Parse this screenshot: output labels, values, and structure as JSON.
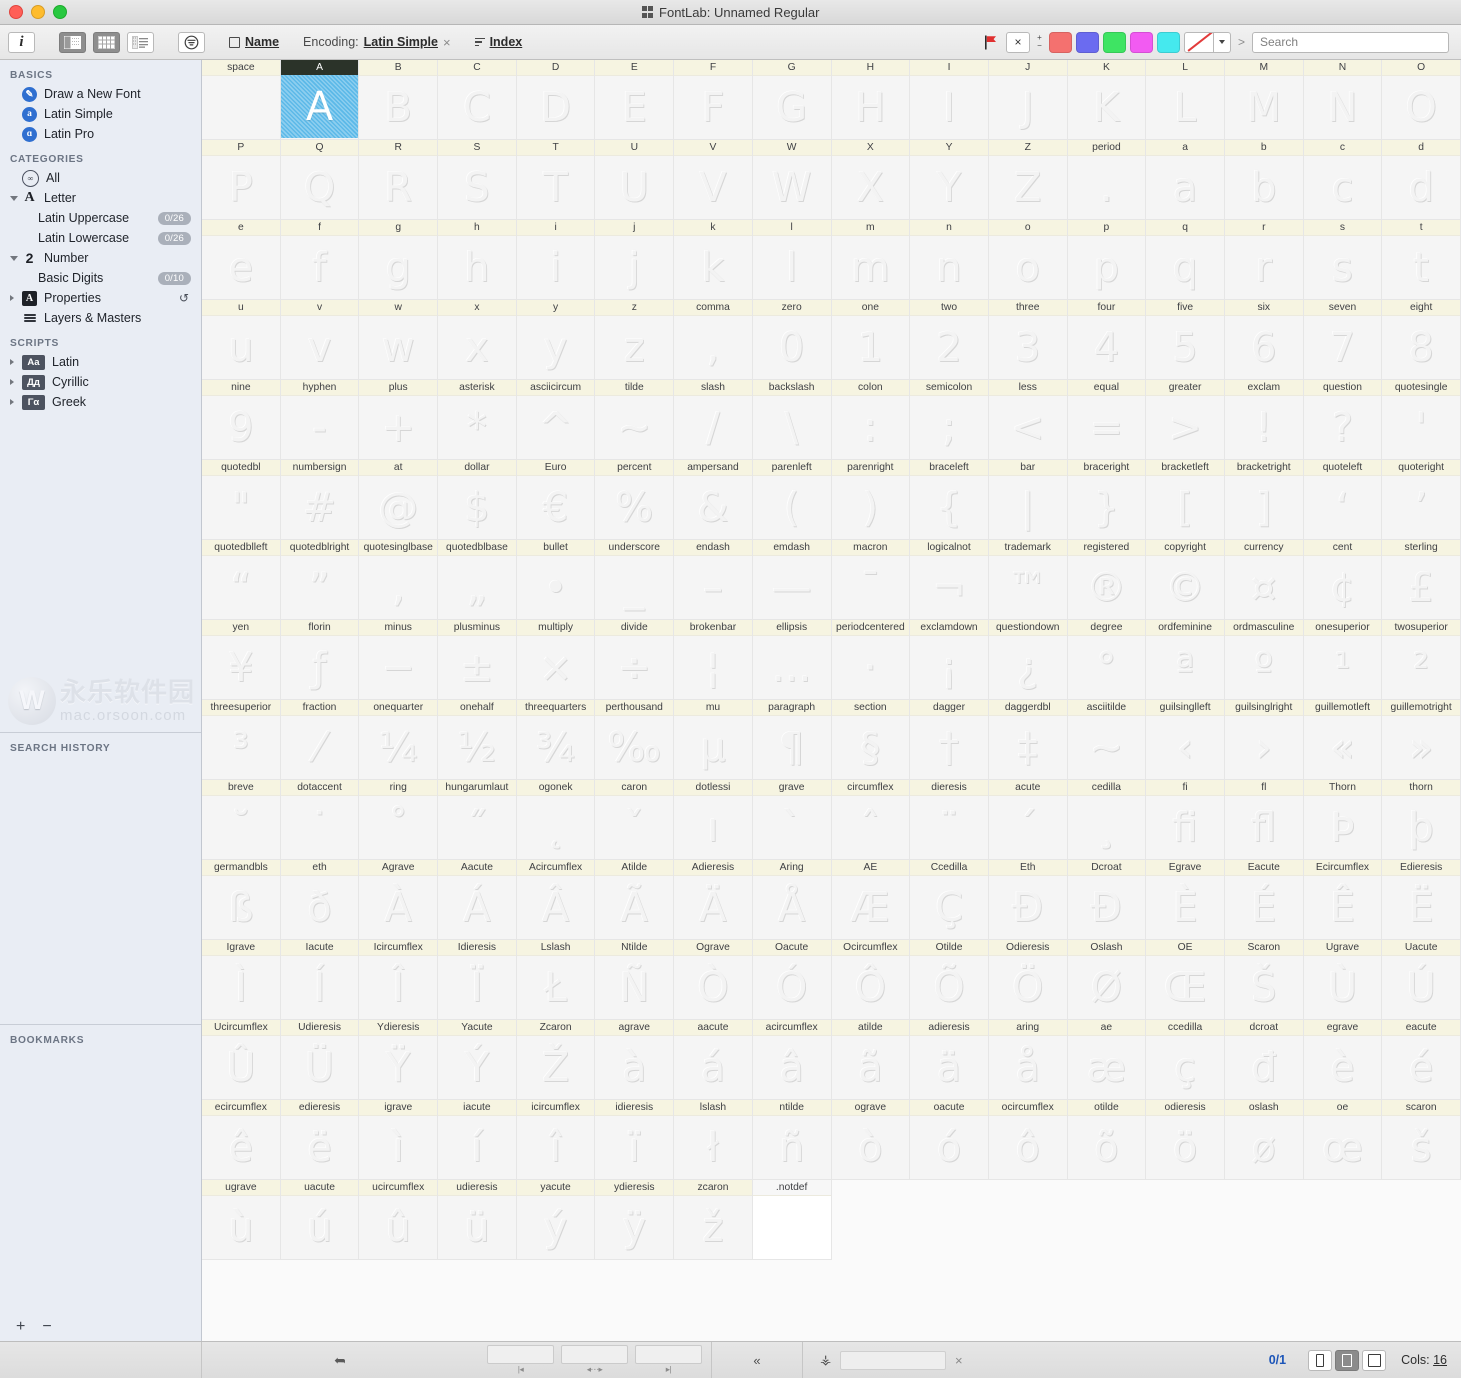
{
  "window": {
    "title": "FontLab: Unnamed Regular",
    "traffic": [
      "close",
      "minimize",
      "zoom"
    ]
  },
  "toolbar": {
    "info_label": "i",
    "view_buttons": [
      "panel-view",
      "grid-view",
      "list-view"
    ],
    "filter_label": "filter",
    "name_label": "Name",
    "encoding_prefix": "Encoding:",
    "encoding_value": "Latin Simple",
    "encoding_clear": "×",
    "index_label": "Index",
    "flag_label": "flag",
    "clear_mark_label": "×",
    "plus_label": "+",
    "minus_label": "−",
    "swatches": [
      "#f4716f",
      "#6b6bf0",
      "#3ee463",
      "#f25bf2",
      "#45e9ee"
    ],
    "slash_label": "no-color",
    "caret_label": "▾",
    "gt_label": ">",
    "search_placeholder": "Search",
    "search_value": ""
  },
  "sidebar": {
    "sections": [
      {
        "title": "BASICS",
        "items": [
          {
            "label": "Draw a New Font",
            "icon": "pen-circle-icon",
            "icon_text": "✐",
            "indent": false
          },
          {
            "label": "Latin Simple",
            "icon": "a-circle-icon",
            "icon_text": "a",
            "indent": false
          },
          {
            "label": "Latin Pro",
            "icon": "a-pro-circle-icon",
            "icon_text": "ɑ",
            "indent": false
          }
        ]
      },
      {
        "title": "CATEGORIES",
        "items": [
          {
            "label": "All",
            "icon": "infinity-circle-icon",
            "icon_text": "∞",
            "indent": false
          },
          {
            "label": "Letter",
            "icon": "letter-a-icon",
            "icon_text": "A",
            "indent": false,
            "disclosure": "open"
          },
          {
            "label": "Latin Uppercase",
            "indent": true,
            "count": "0/26"
          },
          {
            "label": "Latin Lowercase",
            "indent": true,
            "count": "0/26"
          },
          {
            "label": "Number",
            "icon": "number-2-icon",
            "icon_text": "2",
            "indent": false,
            "disclosure": "open"
          },
          {
            "label": "Basic Digits",
            "indent": true,
            "count": "0/10"
          },
          {
            "label": "Properties",
            "icon": "properties-icon",
            "icon_text": "A",
            "indent": false,
            "disclosure": "closed",
            "accessory": "↺"
          },
          {
            "label": "Layers & Masters",
            "icon": "layers-icon",
            "indent": false
          }
        ]
      },
      {
        "title": "SCRIPTS",
        "items": [
          {
            "label": "Latin",
            "icon": "script-latin-icon",
            "icon_text": "Aa",
            "indent": false,
            "disclosure": "closed"
          },
          {
            "label": "Cyrillic",
            "icon": "script-cyrillic-icon",
            "icon_text": "Дд",
            "indent": false,
            "disclosure": "closed"
          },
          {
            "label": "Greek",
            "icon": "script-greek-icon",
            "icon_text": "Γα",
            "indent": false,
            "disclosure": "closed"
          }
        ]
      }
    ],
    "watermark": {
      "cn": "永乐软件园",
      "en": "mac.orsoon.com",
      "mark": "W"
    },
    "search_history_title": "SEARCH HISTORY",
    "bookmarks_title": "BOOKMARKS",
    "footer": {
      "add": "+",
      "remove": "−"
    }
  },
  "statusbar": {
    "cursor_icon": "cursor-icon",
    "slider_hints": [
      "|◂",
      "◂⋯▸",
      "▸|"
    ],
    "collapse_icon": "«",
    "stamp_icon": "stamp-icon",
    "lock_clear": "×",
    "selection_count": "0/1",
    "view_modes": [
      "narrow",
      "medium",
      "wide"
    ],
    "active_view_mode": 1,
    "cols_label": "Cols:",
    "cols_value": "16"
  },
  "grid": {
    "columns": 16,
    "selected": "A",
    "cells": [
      {
        "name": "space",
        "glyph": ""
      },
      {
        "name": "A",
        "glyph": "A",
        "selected": true
      },
      {
        "name": "B",
        "glyph": "B"
      },
      {
        "name": "C",
        "glyph": "C"
      },
      {
        "name": "D",
        "glyph": "D"
      },
      {
        "name": "E",
        "glyph": "E"
      },
      {
        "name": "F",
        "glyph": "F"
      },
      {
        "name": "G",
        "glyph": "G"
      },
      {
        "name": "H",
        "glyph": "H"
      },
      {
        "name": "I",
        "glyph": "I"
      },
      {
        "name": "J",
        "glyph": "J"
      },
      {
        "name": "K",
        "glyph": "K"
      },
      {
        "name": "L",
        "glyph": "L"
      },
      {
        "name": "M",
        "glyph": "M"
      },
      {
        "name": "N",
        "glyph": "N"
      },
      {
        "name": "O",
        "glyph": "O"
      },
      {
        "name": "P",
        "glyph": "P"
      },
      {
        "name": "Q",
        "glyph": "Q"
      },
      {
        "name": "R",
        "glyph": "R"
      },
      {
        "name": "S",
        "glyph": "S"
      },
      {
        "name": "T",
        "glyph": "T"
      },
      {
        "name": "U",
        "glyph": "U"
      },
      {
        "name": "V",
        "glyph": "V"
      },
      {
        "name": "W",
        "glyph": "W"
      },
      {
        "name": "X",
        "glyph": "X"
      },
      {
        "name": "Y",
        "glyph": "Y"
      },
      {
        "name": "Z",
        "glyph": "Z"
      },
      {
        "name": "period",
        "glyph": "."
      },
      {
        "name": "a",
        "glyph": "a"
      },
      {
        "name": "b",
        "glyph": "b"
      },
      {
        "name": "c",
        "glyph": "c"
      },
      {
        "name": "d",
        "glyph": "d"
      },
      {
        "name": "e",
        "glyph": "e"
      },
      {
        "name": "f",
        "glyph": "f"
      },
      {
        "name": "g",
        "glyph": "g"
      },
      {
        "name": "h",
        "glyph": "h"
      },
      {
        "name": "i",
        "glyph": "i"
      },
      {
        "name": "j",
        "glyph": "j"
      },
      {
        "name": "k",
        "glyph": "k"
      },
      {
        "name": "l",
        "glyph": "l"
      },
      {
        "name": "m",
        "glyph": "m"
      },
      {
        "name": "n",
        "glyph": "n"
      },
      {
        "name": "o",
        "glyph": "o"
      },
      {
        "name": "p",
        "glyph": "p"
      },
      {
        "name": "q",
        "glyph": "q"
      },
      {
        "name": "r",
        "glyph": "r"
      },
      {
        "name": "s",
        "glyph": "s"
      },
      {
        "name": "t",
        "glyph": "t"
      },
      {
        "name": "u",
        "glyph": "u"
      },
      {
        "name": "v",
        "glyph": "v"
      },
      {
        "name": "w",
        "glyph": "w"
      },
      {
        "name": "x",
        "glyph": "x"
      },
      {
        "name": "y",
        "glyph": "y"
      },
      {
        "name": "z",
        "glyph": "z"
      },
      {
        "name": "comma",
        "glyph": ","
      },
      {
        "name": "zero",
        "glyph": "0"
      },
      {
        "name": "one",
        "glyph": "1"
      },
      {
        "name": "two",
        "glyph": "2"
      },
      {
        "name": "three",
        "glyph": "3"
      },
      {
        "name": "four",
        "glyph": "4"
      },
      {
        "name": "five",
        "glyph": "5"
      },
      {
        "name": "six",
        "glyph": "6"
      },
      {
        "name": "seven",
        "glyph": "7"
      },
      {
        "name": "eight",
        "glyph": "8"
      },
      {
        "name": "nine",
        "glyph": "9"
      },
      {
        "name": "hyphen",
        "glyph": "-"
      },
      {
        "name": "plus",
        "glyph": "+"
      },
      {
        "name": "asterisk",
        "glyph": "*"
      },
      {
        "name": "asciicircum",
        "glyph": "^"
      },
      {
        "name": "tilde",
        "glyph": "~"
      },
      {
        "name": "slash",
        "glyph": "/"
      },
      {
        "name": "backslash",
        "glyph": "\\"
      },
      {
        "name": "colon",
        "glyph": ":"
      },
      {
        "name": "semicolon",
        "glyph": ";"
      },
      {
        "name": "less",
        "glyph": "<"
      },
      {
        "name": "equal",
        "glyph": "="
      },
      {
        "name": "greater",
        "glyph": ">"
      },
      {
        "name": "exclam",
        "glyph": "!"
      },
      {
        "name": "question",
        "glyph": "?"
      },
      {
        "name": "quotesingle",
        "glyph": "'"
      },
      {
        "name": "quotedbl",
        "glyph": "\""
      },
      {
        "name": "numbersign",
        "glyph": "#"
      },
      {
        "name": "at",
        "glyph": "@"
      },
      {
        "name": "dollar",
        "glyph": "$"
      },
      {
        "name": "Euro",
        "glyph": "€"
      },
      {
        "name": "percent",
        "glyph": "%"
      },
      {
        "name": "ampersand",
        "glyph": "&"
      },
      {
        "name": "parenleft",
        "glyph": "("
      },
      {
        "name": "parenright",
        "glyph": ")"
      },
      {
        "name": "braceleft",
        "glyph": "{"
      },
      {
        "name": "bar",
        "glyph": "|"
      },
      {
        "name": "braceright",
        "glyph": "}"
      },
      {
        "name": "bracketleft",
        "glyph": "["
      },
      {
        "name": "bracketright",
        "glyph": "]"
      },
      {
        "name": "quoteleft",
        "glyph": "‘"
      },
      {
        "name": "quoteright",
        "glyph": "’"
      },
      {
        "name": "quotedblleft",
        "glyph": "“"
      },
      {
        "name": "quotedblright",
        "glyph": "”"
      },
      {
        "name": "quotesinglbase",
        "glyph": "‚"
      },
      {
        "name": "quotedblbase",
        "glyph": "„"
      },
      {
        "name": "bullet",
        "glyph": "•"
      },
      {
        "name": "underscore",
        "glyph": "_"
      },
      {
        "name": "endash",
        "glyph": "–"
      },
      {
        "name": "emdash",
        "glyph": "—"
      },
      {
        "name": "macron",
        "glyph": "¯"
      },
      {
        "name": "logicalnot",
        "glyph": "¬"
      },
      {
        "name": "trademark",
        "glyph": "™"
      },
      {
        "name": "registered",
        "glyph": "®"
      },
      {
        "name": "copyright",
        "glyph": "©"
      },
      {
        "name": "currency",
        "glyph": "¤"
      },
      {
        "name": "cent",
        "glyph": "¢"
      },
      {
        "name": "sterling",
        "glyph": "£"
      },
      {
        "name": "yen",
        "glyph": "¥"
      },
      {
        "name": "florin",
        "glyph": "ƒ"
      },
      {
        "name": "minus",
        "glyph": "−"
      },
      {
        "name": "plusminus",
        "glyph": "±"
      },
      {
        "name": "multiply",
        "glyph": "×"
      },
      {
        "name": "divide",
        "glyph": "÷"
      },
      {
        "name": "brokenbar",
        "glyph": "¦"
      },
      {
        "name": "ellipsis",
        "glyph": "…"
      },
      {
        "name": "periodcentered",
        "glyph": "·"
      },
      {
        "name": "exclamdown",
        "glyph": "¡"
      },
      {
        "name": "questiondown",
        "glyph": "¿"
      },
      {
        "name": "degree",
        "glyph": "°"
      },
      {
        "name": "ordfeminine",
        "glyph": "ª"
      },
      {
        "name": "ordmasculine",
        "glyph": "º"
      },
      {
        "name": "onesuperior",
        "glyph": "¹"
      },
      {
        "name": "twosuperior",
        "glyph": "²"
      },
      {
        "name": "threesuperior",
        "glyph": "³"
      },
      {
        "name": "fraction",
        "glyph": "⁄"
      },
      {
        "name": "onequarter",
        "glyph": "¼"
      },
      {
        "name": "onehalf",
        "glyph": "½"
      },
      {
        "name": "threequarters",
        "glyph": "¾"
      },
      {
        "name": "perthousand",
        "glyph": "‰"
      },
      {
        "name": "mu",
        "glyph": "µ"
      },
      {
        "name": "paragraph",
        "glyph": "¶"
      },
      {
        "name": "section",
        "glyph": "§"
      },
      {
        "name": "dagger",
        "glyph": "†"
      },
      {
        "name": "daggerdbl",
        "glyph": "‡"
      },
      {
        "name": "asciitilde",
        "glyph": "~"
      },
      {
        "name": "guilsinglleft",
        "glyph": "‹"
      },
      {
        "name": "guilsinglright",
        "glyph": "›"
      },
      {
        "name": "guillemotleft",
        "glyph": "«"
      },
      {
        "name": "guillemotright",
        "glyph": "»"
      },
      {
        "name": "breve",
        "glyph": "˘"
      },
      {
        "name": "dotaccent",
        "glyph": "˙"
      },
      {
        "name": "ring",
        "glyph": "˚"
      },
      {
        "name": "hungarumlaut",
        "glyph": "˝"
      },
      {
        "name": "ogonek",
        "glyph": "˛"
      },
      {
        "name": "caron",
        "glyph": "ˇ"
      },
      {
        "name": "dotlessi",
        "glyph": "ı"
      },
      {
        "name": "grave",
        "glyph": "`"
      },
      {
        "name": "circumflex",
        "glyph": "ˆ"
      },
      {
        "name": "dieresis",
        "glyph": "¨"
      },
      {
        "name": "acute",
        "glyph": "´"
      },
      {
        "name": "cedilla",
        "glyph": "¸"
      },
      {
        "name": "fi",
        "glyph": "ﬁ"
      },
      {
        "name": "fl",
        "glyph": "ﬂ"
      },
      {
        "name": "Thorn",
        "glyph": "Þ"
      },
      {
        "name": "thorn",
        "glyph": "þ"
      },
      {
        "name": "germandbls",
        "glyph": "ß"
      },
      {
        "name": "eth",
        "glyph": "ð"
      },
      {
        "name": "Agrave",
        "glyph": "À"
      },
      {
        "name": "Aacute",
        "glyph": "Á"
      },
      {
        "name": "Acircumflex",
        "glyph": "Â"
      },
      {
        "name": "Atilde",
        "glyph": "Ã"
      },
      {
        "name": "Adieresis",
        "glyph": "Ä"
      },
      {
        "name": "Aring",
        "glyph": "Å"
      },
      {
        "name": "AE",
        "glyph": "Æ"
      },
      {
        "name": "Ccedilla",
        "glyph": "Ç"
      },
      {
        "name": "Eth",
        "glyph": "Ð"
      },
      {
        "name": "Dcroat",
        "glyph": "Đ"
      },
      {
        "name": "Egrave",
        "glyph": "È"
      },
      {
        "name": "Eacute",
        "glyph": "É"
      },
      {
        "name": "Ecircumflex",
        "glyph": "Ê"
      },
      {
        "name": "Edieresis",
        "glyph": "Ë"
      },
      {
        "name": "Igrave",
        "glyph": "Ì"
      },
      {
        "name": "Iacute",
        "glyph": "Í"
      },
      {
        "name": "Icircumflex",
        "glyph": "Î"
      },
      {
        "name": "Idieresis",
        "glyph": "Ï"
      },
      {
        "name": "Lslash",
        "glyph": "Ł"
      },
      {
        "name": "Ntilde",
        "glyph": "Ñ"
      },
      {
        "name": "Ograve",
        "glyph": "Ò"
      },
      {
        "name": "Oacute",
        "glyph": "Ó"
      },
      {
        "name": "Ocircumflex",
        "glyph": "Ô"
      },
      {
        "name": "Otilde",
        "glyph": "Õ"
      },
      {
        "name": "Odieresis",
        "glyph": "Ö"
      },
      {
        "name": "Oslash",
        "glyph": "Ø"
      },
      {
        "name": "OE",
        "glyph": "Œ"
      },
      {
        "name": "Scaron",
        "glyph": "Š"
      },
      {
        "name": "Ugrave",
        "glyph": "Ù"
      },
      {
        "name": "Uacute",
        "glyph": "Ú"
      },
      {
        "name": "Ucircumflex",
        "glyph": "Û"
      },
      {
        "name": "Udieresis",
        "glyph": "Ü"
      },
      {
        "name": "Ydieresis",
        "glyph": "Ÿ"
      },
      {
        "name": "Yacute",
        "glyph": "Ý"
      },
      {
        "name": "Zcaron",
        "glyph": "Ž"
      },
      {
        "name": "agrave",
        "glyph": "à"
      },
      {
        "name": "aacute",
        "glyph": "á"
      },
      {
        "name": "acircumflex",
        "glyph": "â"
      },
      {
        "name": "atilde",
        "glyph": "ã"
      },
      {
        "name": "adieresis",
        "glyph": "ä"
      },
      {
        "name": "aring",
        "glyph": "å"
      },
      {
        "name": "ae",
        "glyph": "æ"
      },
      {
        "name": "ccedilla",
        "glyph": "ç"
      },
      {
        "name": "dcroat",
        "glyph": "đ"
      },
      {
        "name": "egrave",
        "glyph": "è"
      },
      {
        "name": "eacute",
        "glyph": "é"
      },
      {
        "name": "ecircumflex",
        "glyph": "ê"
      },
      {
        "name": "edieresis",
        "glyph": "ë"
      },
      {
        "name": "igrave",
        "glyph": "ì"
      },
      {
        "name": "iacute",
        "glyph": "í"
      },
      {
        "name": "icircumflex",
        "glyph": "î"
      },
      {
        "name": "idieresis",
        "glyph": "ï"
      },
      {
        "name": "lslash",
        "glyph": "ł"
      },
      {
        "name": "ntilde",
        "glyph": "ñ"
      },
      {
        "name": "ograve",
        "glyph": "ò"
      },
      {
        "name": "oacute",
        "glyph": "ó"
      },
      {
        "name": "ocircumflex",
        "glyph": "ô"
      },
      {
        "name": "otilde",
        "glyph": "õ"
      },
      {
        "name": "odieresis",
        "glyph": "ö"
      },
      {
        "name": "oslash",
        "glyph": "ø"
      },
      {
        "name": "oe",
        "glyph": "œ"
      },
      {
        "name": "scaron",
        "glyph": "š"
      },
      {
        "name": "ugrave",
        "glyph": "ù"
      },
      {
        "name": "uacute",
        "glyph": "ú"
      },
      {
        "name": "ucircumflex",
        "glyph": "û"
      },
      {
        "name": "udieresis",
        "glyph": "ü"
      },
      {
        "name": "yacute",
        "glyph": "ý"
      },
      {
        "name": "ydieresis",
        "glyph": "ÿ"
      },
      {
        "name": "zcaron",
        "glyph": "ž"
      },
      {
        "name": ".notdef",
        "glyph": "",
        "notdef": true
      }
    ]
  }
}
